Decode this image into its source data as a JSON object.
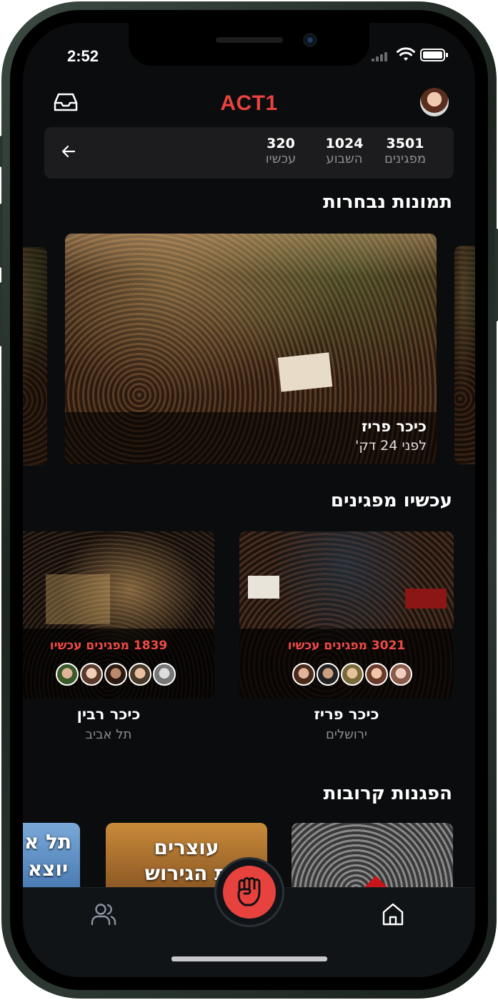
{
  "status_bar": {
    "time": "2:52"
  },
  "header": {
    "title": "ACT1"
  },
  "stats": [
    {
      "value": "3501",
      "label": "מפגינים"
    },
    {
      "value": "1024",
      "label": "השבוע"
    },
    {
      "value": "320",
      "label": "עכשיו"
    }
  ],
  "featured": {
    "heading": "תמונות נבחרות",
    "main": {
      "title": "כיכר פריז",
      "time": "לפני 24 דק'"
    }
  },
  "protesting_now": {
    "heading": "עכשיו מפגינים",
    "cards": [
      {
        "count_text": "3021 מפגינים עכשיו",
        "title": "כיכר פריז",
        "city": "ירושלים"
      },
      {
        "count_text": "1839 מפגינים עכשיו",
        "title": "כיכר רבין",
        "city": "תל אביב"
      }
    ]
  },
  "nearby": {
    "heading": "הפגנות קרובות",
    "cards": [
      {
        "text_line1": "עוצרים",
        "text_line2": "ת הגירוש"
      },
      {
        "text_line1": "תל א",
        "text_line2": "יוצא"
      }
    ]
  },
  "colors": {
    "accent": "#e8423f",
    "background": "#0b0c0e",
    "surface": "#1c1c1e"
  },
  "icons": {
    "header_left": "inbox-icon",
    "header_right": "avatar",
    "stats_back": "arrow-left-icon",
    "tab_left": "people-icon",
    "tab_center": "fist-icon",
    "tab_right": "home-icon"
  }
}
